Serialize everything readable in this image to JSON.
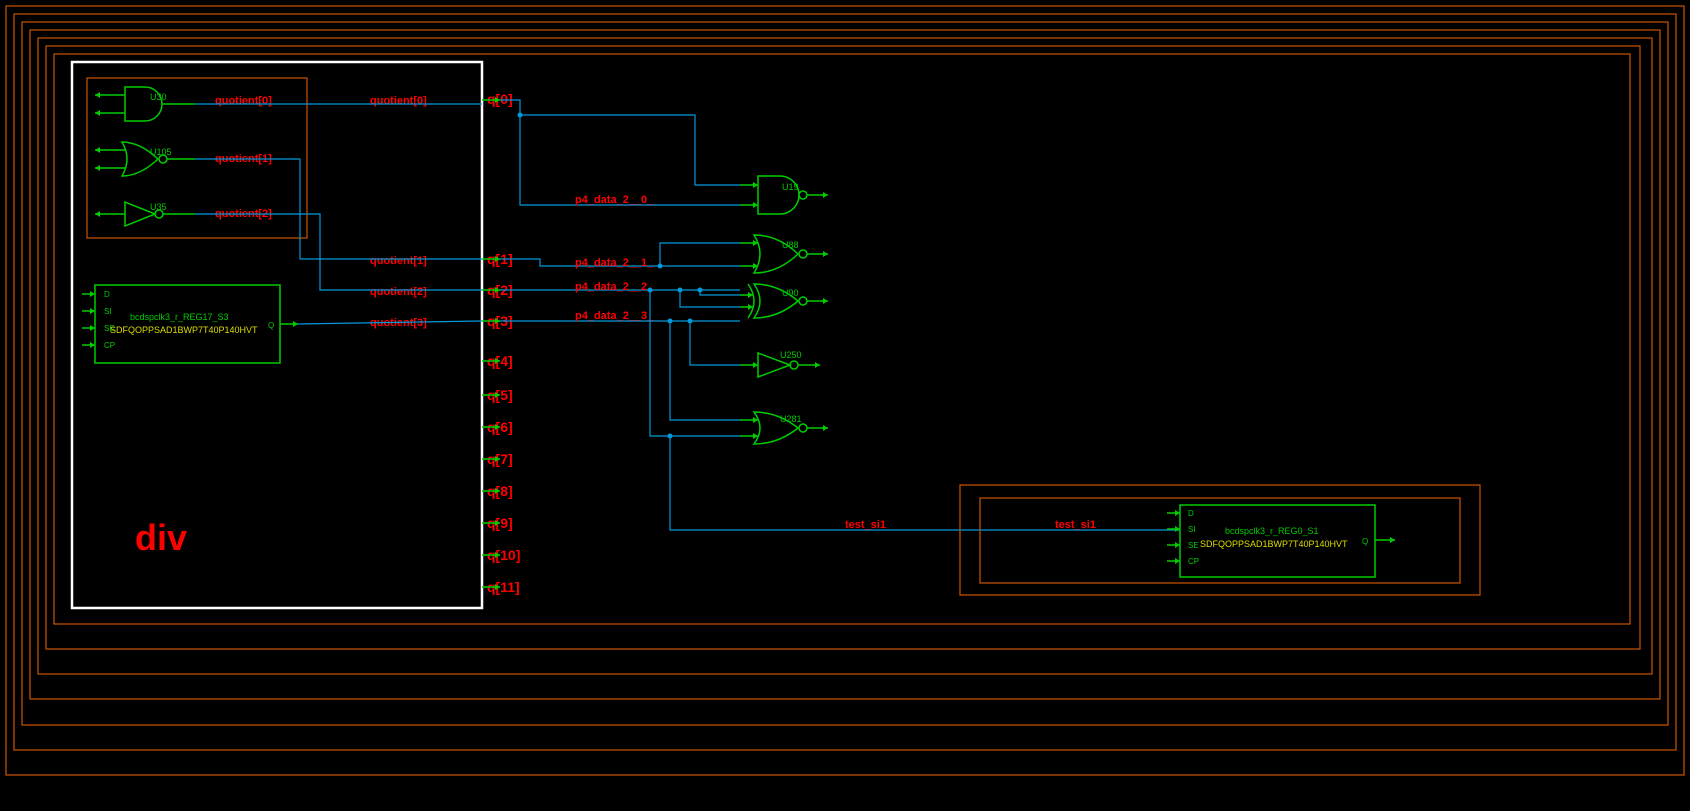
{
  "div_block": {
    "label": "div"
  },
  "gates_left": {
    "u30": {
      "name": "U30",
      "signal": "quotient[0]"
    },
    "u105": {
      "name": "U105",
      "signal": "quotient[1]"
    },
    "u35": {
      "name": "U35",
      "signal": "quotient[2]"
    },
    "quotient_labels": [
      "quotient[0]",
      "quotient[1]",
      "quotient[2]",
      "quotient[3]"
    ]
  },
  "reg_left": {
    "inst": "bcdspclk3_r_REG17_S3",
    "cell": "SDFQOPPSAD1BWP7T40P140HVT",
    "pins": [
      "D",
      "SI",
      "SE",
      "CP",
      "Q"
    ]
  },
  "ports": [
    "q[0]",
    "q[1]",
    "q[2]",
    "q[3]",
    "q[4]",
    "q[5]",
    "q[6]",
    "q[7]",
    "q[8]",
    "q[9]",
    "q[10]",
    "q[11]"
  ],
  "p4_signals": [
    "p4_data_2__0_",
    "p4_data_2__1_",
    "p4_data_2__2_",
    "p4_data_2__3_"
  ],
  "test_signal": "test_si1",
  "gates_right": {
    "u19": "U19",
    "u88": "U88",
    "u90": "U90",
    "u250": "U250",
    "u281": "U281"
  },
  "reg_right": {
    "inst": "bcdspclk3_r_REG0_S1",
    "cell": "SDFQOPPSAD1BWP7T40P140HVT",
    "pins": [
      "D",
      "SI",
      "SE",
      "CP",
      "Q"
    ]
  }
}
